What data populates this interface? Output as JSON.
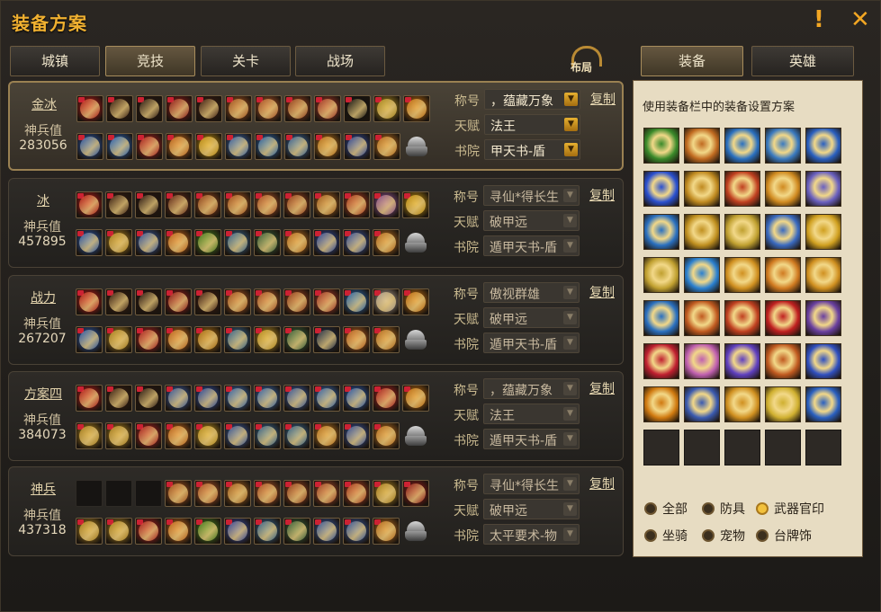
{
  "window": {
    "title": "装备方案",
    "help_icon": "!",
    "close_icon": "close-icon"
  },
  "tabs": [
    "城镇",
    "竞技",
    "关卡",
    "战场"
  ],
  "active_tab": 1,
  "layout_button": "布局",
  "right_tabs": [
    "装备",
    "英雄"
  ],
  "right_desc": "使用装备栏中的装备设置方案",
  "field_labels": {
    "title": "称号",
    "talent": "天赋",
    "academy": "书院"
  },
  "copy_label": "复制",
  "power_label": "神兵值",
  "rows": [
    {
      "name": "金冰",
      "power": "283056",
      "title": "，蕴藏万象",
      "talent": "法王",
      "academy": "甲天书-盾",
      "selected": true,
      "top": [
        "#c81818",
        "#3a1c10",
        "#281410",
        "#a01818",
        "#401a10",
        "#b85a20",
        "#c05a28",
        "#a8451e",
        "#b83a28",
        "#101010",
        "#c09a20",
        "#d87a10"
      ],
      "bottom": [
        "#2a60c0",
        "#2a6fd0",
        "#c02020",
        "#d8701c",
        "#d8a010",
        "#3a6fc0",
        "#2a70c0",
        "#3a70b0",
        "#d0801c",
        "#3050b0",
        "#d07a20"
      ]
    },
    {
      "name": "冰",
      "power": "457895",
      "title": "寻仙*得长生",
      "talent": "破甲远",
      "academy": "遁甲天书-盾",
      "selected": false,
      "top": [
        "#c81818",
        "#3a1c10",
        "#281410",
        "#6a2a18",
        "#a24a1c",
        "#b85a20",
        "#c05a28",
        "#a8451e",
        "#b86a20",
        "#c04020",
        "#9a5aa0",
        "#d8a010"
      ],
      "bottom": [
        "#2a60c0",
        "#c09020",
        "#3a60b0",
        "#d8701c",
        "#4a8a20",
        "#3a70a0",
        "#3a6a40",
        "#d07a20",
        "#3050b0",
        "#3a5ab0",
        "#d07a20"
      ]
    },
    {
      "name": "战力",
      "power": "267207",
      "title": "傲视群雄",
      "talent": "破甲远",
      "academy": "遁甲天书-盾",
      "selected": false,
      "top": [
        "#c81818",
        "#3a1c10",
        "#281410",
        "#a01818",
        "#401a10",
        "#b85a20",
        "#c05a28",
        "#a8451e",
        "#b83a28",
        "#2a70c0",
        "#c0b0a0",
        "#d87a10"
      ],
      "bottom": [
        "#2a60c0",
        "#c09020",
        "#c02020",
        "#d8701c",
        "#c07a10",
        "#3a70a0",
        "#d0a020",
        "#3a6a40",
        "#203050",
        "#d06a20",
        "#d07a20"
      ]
    },
    {
      "name": "方案四",
      "power": "384073",
      "title": "，蕴藏万象",
      "talent": "法王",
      "academy": "遁甲天书-盾",
      "selected": false,
      "top": [
        "#c81818",
        "#3a1c10",
        "#281410",
        "#3a60b0",
        "#2a50b0",
        "#3a70c0",
        "#3a70c0",
        "#3a60b0",
        "#3a70c0",
        "#2a60c0",
        "#c02020",
        "#d87a10"
      ],
      "bottom": [
        "#c09020",
        "#c09020",
        "#c02020",
        "#d8701c",
        "#d0a020",
        "#3a60b0",
        "#3a70a0",
        "#3a70a0",
        "#d08020",
        "#3a5ab0",
        "#d07a20"
      ]
    },
    {
      "name": "神兵",
      "power": "437318",
      "title": "寻仙*得长生",
      "talent": "破甲远",
      "academy": "太平要术-物",
      "selected": false,
      "top": [
        "#161412",
        "#161412",
        "#161412",
        "#b85a20",
        "#c05a28",
        "#b86a20",
        "#c05a28",
        "#a8451e",
        "#b84a28",
        "#c04020",
        "#c09020",
        "#a01818"
      ],
      "bottom": [
        "#c09020",
        "#c09020",
        "#c02020",
        "#d8701c",
        "#4a8a20",
        "#3a50b0",
        "#3a70a0",
        "#3a6a40",
        "#3a60b0",
        "#3a60b0",
        "#d07a20"
      ]
    }
  ],
  "grid_colors": [
    "#3a8a2a",
    "#c06a20",
    "#2a70c0",
    "#3a7ac0",
    "#2a60c0",
    "#2a50d0",
    "#c08a20",
    "#c04020",
    "#d08a20",
    "#6a60c0",
    "#2a70c0",
    "#c09020",
    "#c0a030",
    "#3a6ac0",
    "#d0a020",
    "#c0a030",
    "#2a80d0",
    "#d09020",
    "#d07a20",
    "#d09020",
    "#2a70c0",
    "#c05a20",
    "#c04020",
    "#c02020",
    "#6a40a0",
    "#c02030",
    "#c060b0",
    "#6040c0",
    "#c05a20",
    "#3050c0",
    "#d07a10",
    "#3a5ab0",
    "#d09020",
    "#d0b030",
    "#2a60c0"
  ],
  "empty_slots": 5,
  "filters": [
    {
      "label": "全部",
      "on": false
    },
    {
      "label": "防具",
      "on": false
    },
    {
      "label": "武器官印",
      "on": true
    },
    {
      "label": "坐骑",
      "on": false
    },
    {
      "label": "宠物",
      "on": false
    },
    {
      "label": "台牌饰",
      "on": false
    }
  ]
}
